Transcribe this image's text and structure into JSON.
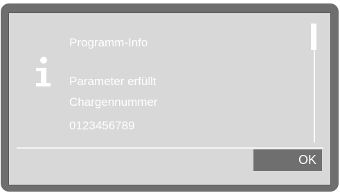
{
  "dialog": {
    "title": "Programm-Info",
    "lines": [
      "Parameter erfüllt",
      "Chargennummer",
      "0123456789"
    ],
    "icon": "info-icon",
    "ok_label": "OK"
  },
  "colors": {
    "bezel": "#6e6e6e",
    "screen": "#d8d8d8",
    "text": "#ffffff",
    "button": "#6f6f6f"
  }
}
